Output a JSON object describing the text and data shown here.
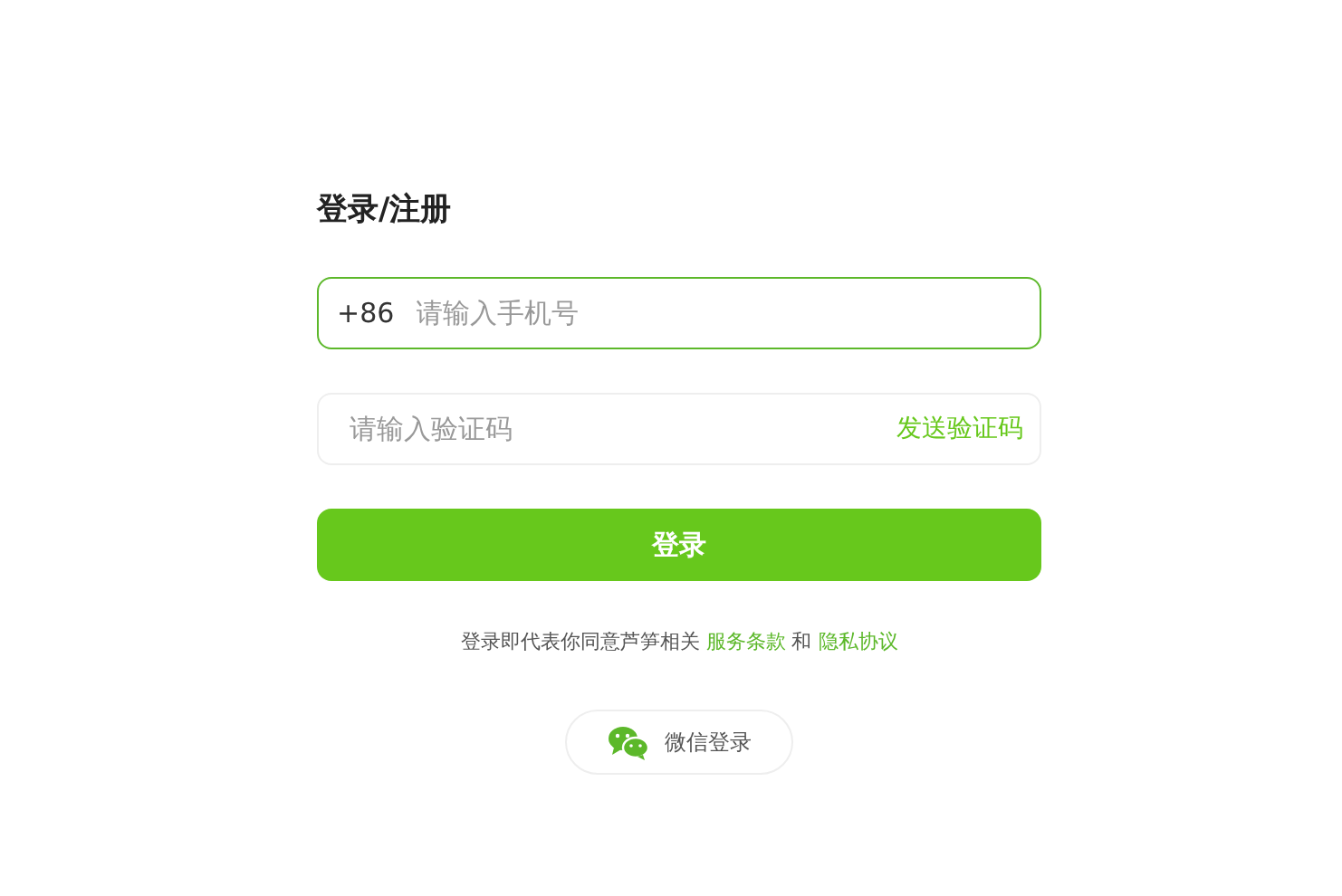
{
  "title": "登录/注册",
  "phone_field": {
    "prefix": "+86",
    "placeholder": "请输入手机号",
    "focused": true
  },
  "code_field": {
    "placeholder": "请输入验证码",
    "focused": false,
    "send_code": "发送验证码"
  },
  "login_button": "登录",
  "agreement": {
    "text": "登录即代表你同意芦笋相关",
    "terms": "服务条款",
    "conjunction": "和",
    "privacy": "隐私协议"
  },
  "wechat_login": "微信登录"
}
